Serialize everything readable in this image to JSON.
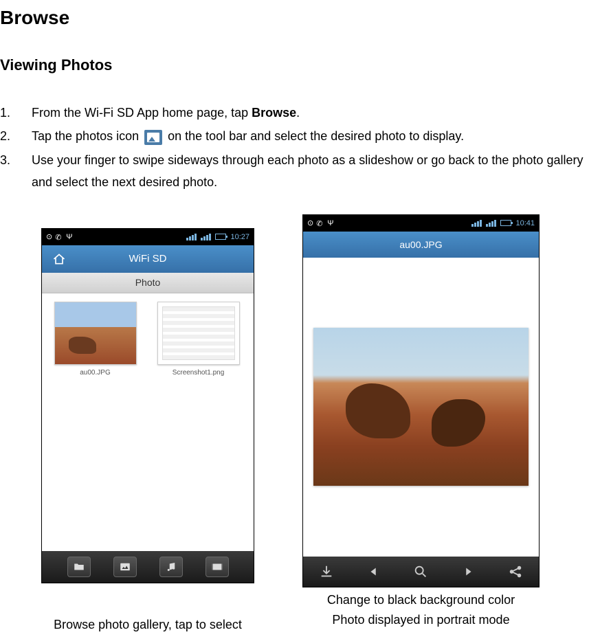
{
  "title": "Browse",
  "section_title": "Viewing Photos",
  "instructions": [
    {
      "number": "1.",
      "pre": "From the Wi-Fi SD App home page, tap ",
      "bold": "Browse",
      "post": "."
    },
    {
      "number": "2.",
      "pre": "Tap the photos icon ",
      "icon": true,
      "post": " on the tool bar and select the desired photo to display."
    },
    {
      "number": "3.",
      "text": "Use your finger to swipe sideways through each photo as a slideshow or go back to the photo gallery and select the next desired photo."
    }
  ],
  "left_screenshot": {
    "status_time": "10:27",
    "header_title": "WiFi SD",
    "sub_header": "Photo",
    "thumbs": [
      {
        "label": "au00.JPG"
      },
      {
        "label": "Screenshot1.png"
      }
    ]
  },
  "right_screenshot": {
    "status_time": "10:41",
    "header_title": "au00.JPG"
  },
  "captions": {
    "left": "Browse photo gallery, tap to select",
    "right_extra": "Change to black background color",
    "right": "Photo displayed in portrait mode"
  }
}
